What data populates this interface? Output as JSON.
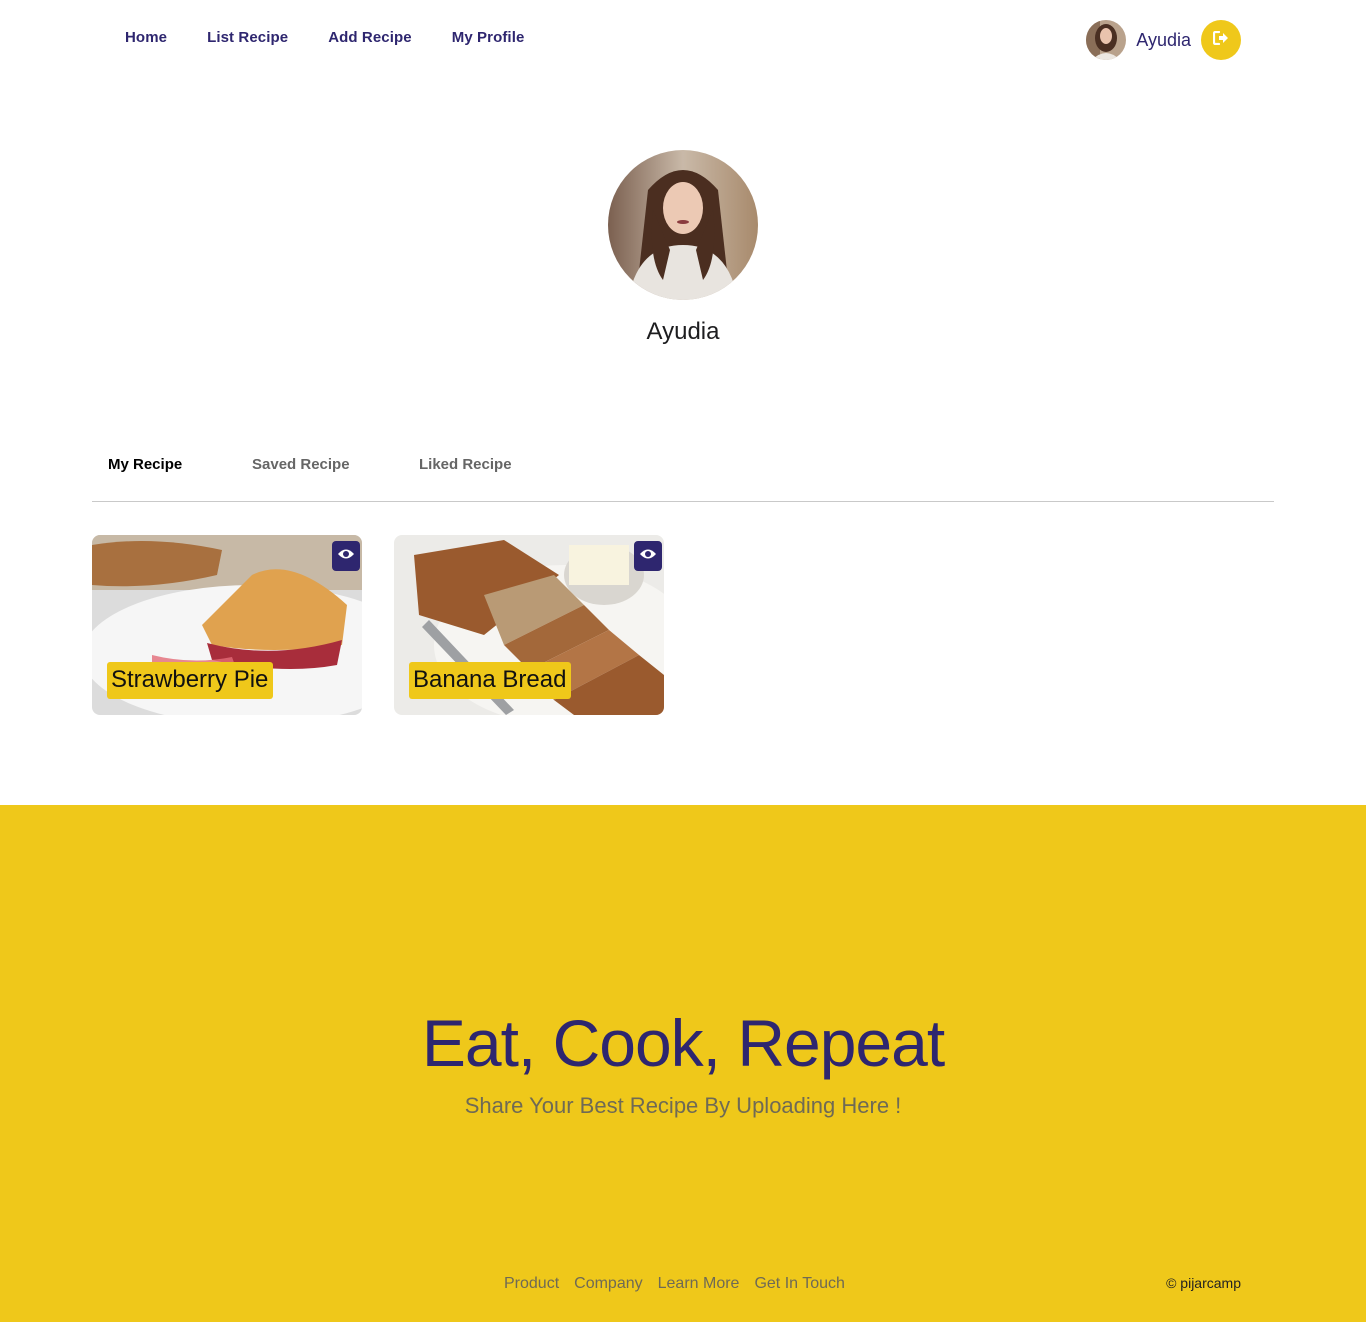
{
  "nav": {
    "links": [
      "Home",
      "List Recipe",
      "Add Recipe",
      "My Profile"
    ],
    "user": {
      "name": "Ayudia",
      "logout_icon": "logout-icon"
    }
  },
  "profile": {
    "name": "Ayudia"
  },
  "tabs": [
    {
      "label": "My Recipe",
      "active": true
    },
    {
      "label": "Saved Recipe",
      "active": false
    },
    {
      "label": "Liked Recipe",
      "active": false
    }
  ],
  "recipes": [
    {
      "title": "Strawberry Pie",
      "action_icon": "eye-icon"
    },
    {
      "title": "Banana Bread",
      "action_icon": "eye-icon"
    }
  ],
  "footer": {
    "title": "Eat, Cook, Repeat",
    "subtitle": "Share Your Best Recipe By Uploading Here !",
    "links": [
      "Product",
      "Company",
      "Learn More",
      "Get In Touch"
    ],
    "copyright": "© pijarcamp"
  },
  "colors": {
    "primary": "#2e266f",
    "accent": "#efc81a"
  }
}
